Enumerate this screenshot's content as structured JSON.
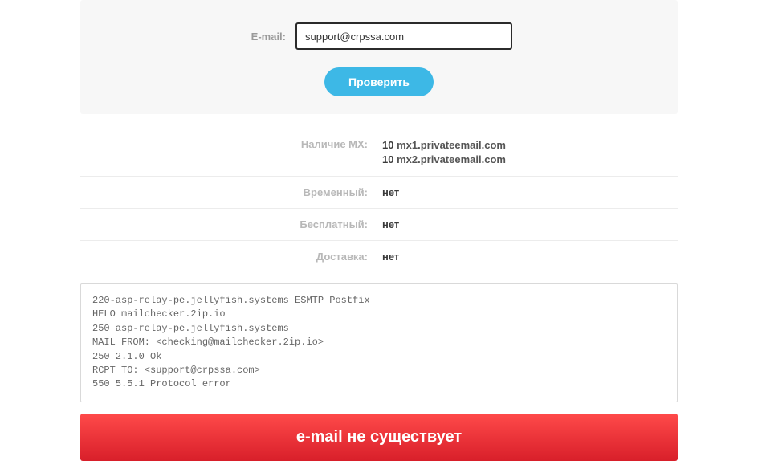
{
  "form": {
    "email_label": "E-mail:",
    "email_value": "support@crpssa.com",
    "submit_label": "Проверить"
  },
  "results": {
    "mx": {
      "label": "Наличие MX:",
      "records": [
        {
          "priority": "10",
          "host": "mx1.privateemail.com"
        },
        {
          "priority": "10",
          "host": "mx2.privateemail.com"
        }
      ]
    },
    "temporary": {
      "label": "Временный:",
      "value": "нет"
    },
    "free": {
      "label": "Бесплатный:",
      "value": "нет"
    },
    "delivery": {
      "label": "Доставка:",
      "value": "нет"
    }
  },
  "log": "220-asp-relay-pe.jellyfish.systems ESMTP Postfix\nHELO mailchecker.2ip.io\n250 asp-relay-pe.jellyfish.systems\nMAIL FROM: <checking@mailchecker.2ip.io>\n250 2.1.0 Ok\nRCPT TO: <support@crpssa.com>\n550 5.5.1 Protocol error",
  "status": {
    "text": "e-mail не существует",
    "color": "#d81f2a"
  }
}
